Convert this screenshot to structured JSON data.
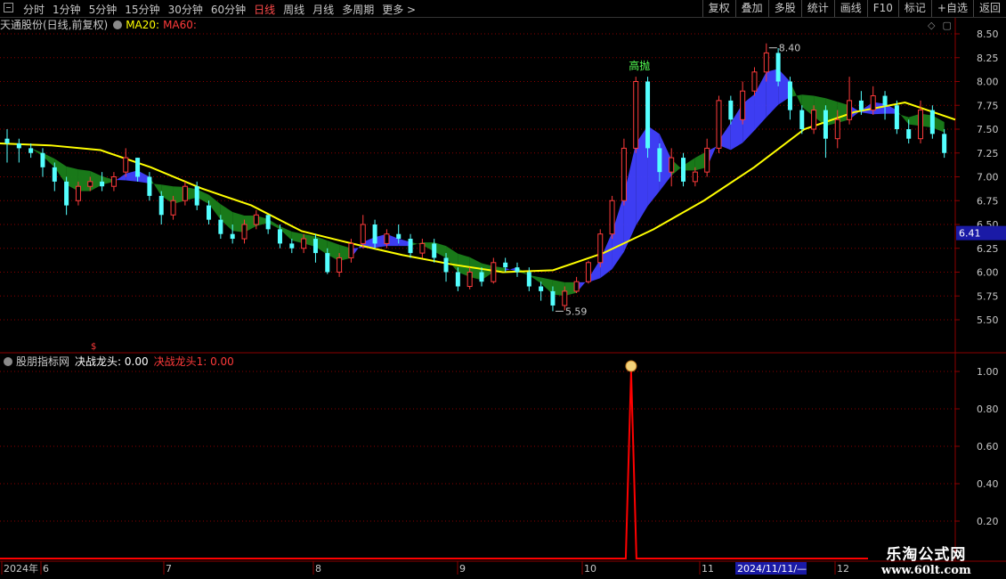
{
  "toolbar": {
    "periods": [
      "分时",
      "1分钟",
      "5分钟",
      "15分钟",
      "30分钟",
      "60分钟",
      "日线",
      "周线",
      "月线",
      "多周期",
      "更多 >"
    ],
    "active_period": "日线",
    "right_tools": [
      "复权",
      "叠加",
      "多股",
      "统计",
      "画线",
      "F10",
      "标记",
      "+自选",
      "返回"
    ]
  },
  "main_header": {
    "stock": "天通股份(日线,前复权)",
    "ma20": "MA20:",
    "ma60": "MA60:"
  },
  "indicator_header": {
    "name": "股朋指标网",
    "line1": "决战龙头: 0.00",
    "line2": "决战龙头1: 0.00"
  },
  "price_axis_labels": [
    "8.50",
    "8.25",
    "8.00",
    "7.75",
    "7.50",
    "7.25",
    "7.00",
    "6.75",
    "6.50",
    "6.25",
    "6.00",
    "5.75",
    "5.50"
  ],
  "current_price": "6.41",
  "indicator_axis_labels": [
    "1.00",
    "0.80",
    "0.60",
    "0.40",
    "0.20"
  ],
  "annotations": {
    "high": "8.40",
    "low": "5.59",
    "signal": "高抛"
  },
  "date_axis": {
    "labels": [
      "2024年",
      "6",
      "7",
      "8",
      "9",
      "10",
      "11",
      "12"
    ],
    "cursor_date": "2024/11/11/—"
  },
  "watermark": {
    "line1": "乐淘公式网",
    "line2": "www.60lt.com"
  },
  "colors": {
    "up": "#ff3b3b",
    "down": "#54ffff",
    "ma60": "#ffff00",
    "band_green": "#1a7f1a",
    "band_blue": "#4040ff",
    "grid": "#8b0000",
    "indicator": "#ff0000"
  },
  "chart_data": {
    "type": "candlestick",
    "ylim": [
      5.4,
      8.6
    ],
    "indicator_ylim": [
      0,
      1.05
    ],
    "x_months": [
      "6",
      "7",
      "8",
      "9",
      "10",
      "11",
      "12"
    ],
    "ma60_values": [
      7.35,
      7.33,
      7.28,
      7.1,
      6.88,
      6.7,
      6.43,
      6.3,
      6.18,
      6.08,
      6.0,
      6.02,
      6.2,
      6.45,
      6.75,
      7.1,
      7.5,
      7.68,
      7.78,
      7.6
    ],
    "candles": [
      [
        7.4,
        7.35,
        7.5,
        7.15
      ],
      [
        7.35,
        7.3,
        7.4,
        7.15
      ],
      [
        7.3,
        7.25,
        7.35,
        7.2
      ],
      [
        7.25,
        7.1,
        7.3,
        7.0
      ],
      [
        7.1,
        6.95,
        7.15,
        6.85
      ],
      [
        6.95,
        6.7,
        7.0,
        6.6
      ],
      [
        6.75,
        6.9,
        6.95,
        6.7
      ],
      [
        6.9,
        6.95,
        7.0,
        6.85
      ],
      [
        6.95,
        6.9,
        7.05,
        6.85
      ],
      [
        6.9,
        7.0,
        7.05,
        6.85
      ],
      [
        7.05,
        7.2,
        7.3,
        7.0
      ],
      [
        7.2,
        7.0,
        7.2,
        6.95
      ],
      [
        7.0,
        6.8,
        7.05,
        6.75
      ],
      [
        6.8,
        6.6,
        6.85,
        6.5
      ],
      [
        6.6,
        6.75,
        6.8,
        6.55
      ],
      [
        6.75,
        6.9,
        6.95,
        6.7
      ],
      [
        6.9,
        6.7,
        6.95,
        6.65
      ],
      [
        6.7,
        6.55,
        6.75,
        6.5
      ],
      [
        6.55,
        6.4,
        6.6,
        6.35
      ],
      [
        6.4,
        6.35,
        6.5,
        6.3
      ],
      [
        6.35,
        6.5,
        6.55,
        6.3
      ],
      [
        6.5,
        6.6,
        6.65,
        6.45
      ],
      [
        6.6,
        6.45,
        6.6,
        6.4
      ],
      [
        6.45,
        6.3,
        6.5,
        6.25
      ],
      [
        6.3,
        6.25,
        6.35,
        6.2
      ],
      [
        6.25,
        6.35,
        6.4,
        6.2
      ],
      [
        6.35,
        6.2,
        6.4,
        6.1
      ],
      [
        6.2,
        6.0,
        6.25,
        5.98
      ],
      [
        6.0,
        6.15,
        6.2,
        5.95
      ],
      [
        6.15,
        6.3,
        6.35,
        6.1
      ],
      [
        6.3,
        6.5,
        6.6,
        6.25
      ],
      [
        6.5,
        6.3,
        6.55,
        6.25
      ],
      [
        6.3,
        6.4,
        6.45,
        6.25
      ],
      [
        6.4,
        6.35,
        6.5,
        6.3
      ],
      [
        6.35,
        6.2,
        6.4,
        6.15
      ],
      [
        6.2,
        6.3,
        6.35,
        6.15
      ],
      [
        6.3,
        6.15,
        6.35,
        6.1
      ],
      [
        6.15,
        6.0,
        6.2,
        5.9
      ],
      [
        6.0,
        5.85,
        6.05,
        5.8
      ],
      [
        5.85,
        6.0,
        6.05,
        5.82
      ],
      [
        6.0,
        5.9,
        6.05,
        5.85
      ],
      [
        5.9,
        6.1,
        6.15,
        5.88
      ],
      [
        6.1,
        6.05,
        6.15,
        6.0
      ],
      [
        6.05,
        6.0,
        6.1,
        5.95
      ],
      [
        6.0,
        5.85,
        6.05,
        5.8
      ],
      [
        5.85,
        5.8,
        5.9,
        5.7
      ],
      [
        5.8,
        5.65,
        5.85,
        5.59
      ],
      [
        5.65,
        5.8,
        5.85,
        5.6
      ],
      [
        5.8,
        5.9,
        5.95,
        5.78
      ],
      [
        5.9,
        6.1,
        6.12,
        5.88
      ],
      [
        6.1,
        6.4,
        6.45,
        6.05
      ],
      [
        6.4,
        6.75,
        6.8,
        6.35
      ],
      [
        6.75,
        7.3,
        7.4,
        6.7
      ],
      [
        7.3,
        8.0,
        8.05,
        7.25
      ],
      [
        8.0,
        7.3,
        8.05,
        7.2
      ],
      [
        7.3,
        7.05,
        7.35,
        6.95
      ],
      [
        7.05,
        7.2,
        7.3,
        6.9
      ],
      [
        7.2,
        6.95,
        7.25,
        6.9
      ],
      [
        6.95,
        7.05,
        7.1,
        6.9
      ],
      [
        7.05,
        7.3,
        7.4,
        7.0
      ],
      [
        7.3,
        7.8,
        7.85,
        7.25
      ],
      [
        7.8,
        7.6,
        7.85,
        7.55
      ],
      [
        7.6,
        7.9,
        8.0,
        7.55
      ],
      [
        7.9,
        8.1,
        8.15,
        7.85
      ],
      [
        8.1,
        8.3,
        8.4,
        8.0
      ],
      [
        8.3,
        8.0,
        8.35,
        7.95
      ],
      [
        8.0,
        7.7,
        8.05,
        7.6
      ],
      [
        7.7,
        7.5,
        7.75,
        7.45
      ],
      [
        7.5,
        7.7,
        7.75,
        7.45
      ],
      [
        7.7,
        7.4,
        7.75,
        7.2
      ],
      [
        7.4,
        7.6,
        7.7,
        7.3
      ],
      [
        7.6,
        7.8,
        8.05,
        7.55
      ],
      [
        7.8,
        7.7,
        7.9,
        7.65
      ],
      [
        7.7,
        7.85,
        7.95,
        7.65
      ],
      [
        7.85,
        7.75,
        7.9,
        7.6
      ],
      [
        7.75,
        7.5,
        7.8,
        7.45
      ],
      [
        7.5,
        7.4,
        7.6,
        7.35
      ],
      [
        7.4,
        7.7,
        7.8,
        7.35
      ],
      [
        7.7,
        7.45,
        7.75,
        7.4
      ],
      [
        7.45,
        7.25,
        7.5,
        7.2
      ]
    ],
    "indicator_spike_index": 52,
    "indicator_spike_value": 1.0
  }
}
